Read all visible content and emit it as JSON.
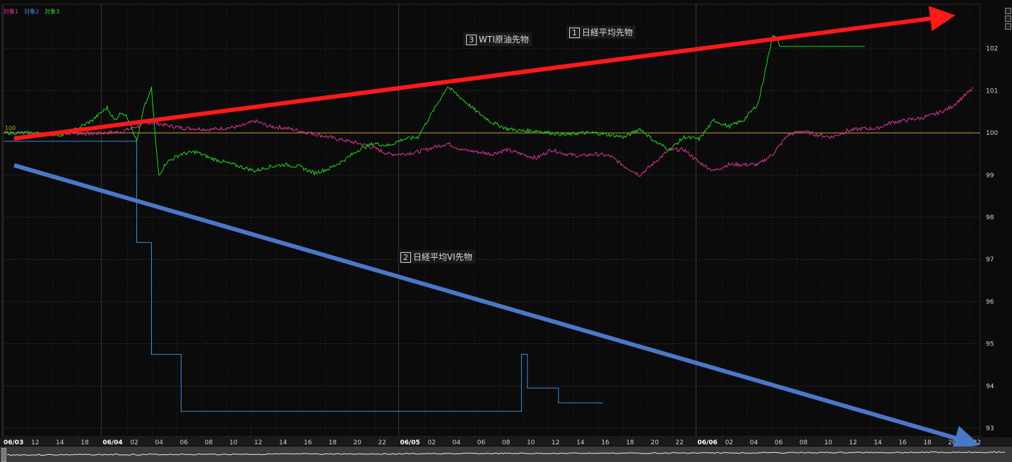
{
  "legend": [
    {
      "name": "対象1",
      "color": "#e0359a"
    },
    {
      "name": "対象2",
      "color": "#3b8ede"
    },
    {
      "name": "対象3",
      "color": "#22d622"
    }
  ],
  "annotations": [
    {
      "num": "1",
      "text": "日経平均先物"
    },
    {
      "num": "2",
      "text": "日経平均VI先物"
    },
    {
      "num": "3",
      "text": "WTI原油先物"
    }
  ],
  "chart_data": {
    "type": "line",
    "baseline": {
      "value": 100,
      "label": "100",
      "color": "#c8a020"
    },
    "y_ticks": [
      "102",
      "101",
      "100",
      "99",
      "98",
      "97",
      "96",
      "95",
      "94",
      "93"
    ],
    "ylim": [
      92.8,
      103.05
    ],
    "x_ticks": [
      {
        "label": "06/03",
        "bold": true
      },
      {
        "label": "12"
      },
      {
        "label": "14"
      },
      {
        "label": "18"
      },
      {
        "label": "06/04",
        "bold": true
      },
      {
        "label": "02"
      },
      {
        "label": "04"
      },
      {
        "label": "06"
      },
      {
        "label": "08"
      },
      {
        "label": "10"
      },
      {
        "label": "12"
      },
      {
        "label": "14"
      },
      {
        "label": "16"
      },
      {
        "label": "18"
      },
      {
        "label": "20"
      },
      {
        "label": "22"
      },
      {
        "label": "06/05",
        "bold": true
      },
      {
        "label": "02"
      },
      {
        "label": "04"
      },
      {
        "label": "06"
      },
      {
        "label": "08"
      },
      {
        "label": "10"
      },
      {
        "label": "12"
      },
      {
        "label": "14"
      },
      {
        "label": "16"
      },
      {
        "label": "18"
      },
      {
        "label": "20"
      },
      {
        "label": "22"
      },
      {
        "label": "06/06",
        "bold": true
      },
      {
        "label": "02"
      },
      {
        "label": "04"
      },
      {
        "label": "06"
      },
      {
        "label": "08"
      },
      {
        "label": "10"
      },
      {
        "label": "12"
      },
      {
        "label": "14"
      },
      {
        "label": "16"
      },
      {
        "label": "18"
      },
      {
        "label": "20"
      },
      {
        "label": "22"
      }
    ],
    "series": [
      {
        "name": "対象1",
        "color": "#e0359a",
        "points": [
          [
            0,
            100
          ],
          [
            2,
            100
          ],
          [
            4,
            100
          ],
          [
            6,
            99.98
          ],
          [
            8,
            100.03
          ],
          [
            9,
            100.15
          ],
          [
            10,
            100.25
          ],
          [
            11,
            100.18
          ],
          [
            12,
            100.12
          ],
          [
            14,
            100.08
          ],
          [
            16,
            100.15
          ],
          [
            17,
            100.28
          ],
          [
            18,
            100.15
          ],
          [
            19,
            100.12
          ],
          [
            20,
            100.05
          ],
          [
            22,
            99.9
          ],
          [
            24,
            99.75
          ],
          [
            25,
            99.65
          ],
          [
            26,
            99.5
          ],
          [
            27,
            99.5
          ],
          [
            28,
            99.55
          ],
          [
            29,
            99.65
          ],
          [
            30,
            99.75
          ],
          [
            31,
            99.6
          ],
          [
            32,
            99.55
          ],
          [
            33,
            99.5
          ],
          [
            34,
            99.6
          ],
          [
            35,
            99.5
          ],
          [
            36,
            99.4
          ],
          [
            37,
            99.6
          ],
          [
            38,
            99.5
          ],
          [
            39,
            99.45
          ],
          [
            40,
            99.5
          ],
          [
            41,
            99.45
          ],
          [
            42,
            99.2
          ],
          [
            43,
            99
          ],
          [
            44,
            99.3
          ],
          [
            45,
            99.6
          ],
          [
            46,
            99.6
          ],
          [
            47,
            99.3
          ],
          [
            48,
            99.1
          ],
          [
            49,
            99.25
          ],
          [
            50,
            99.25
          ],
          [
            51,
            99.25
          ],
          [
            52,
            99.5
          ],
          [
            53,
            99.95
          ],
          [
            54,
            100.05
          ],
          [
            55,
            99.95
          ],
          [
            56,
            99.9
          ],
          [
            57,
            100.05
          ],
          [
            58,
            100.1
          ],
          [
            59,
            100.1
          ],
          [
            60,
            100.25
          ],
          [
            61,
            100.3
          ],
          [
            62,
            100.35
          ],
          [
            63,
            100.45
          ],
          [
            64,
            100.6
          ],
          [
            65,
            100.9
          ],
          [
            65.5,
            101.05
          ]
        ]
      },
      {
        "name": "対象2",
        "color": "#3b8ede",
        "points": [
          [
            0,
            99.8
          ],
          [
            9,
            99.8
          ],
          [
            9,
            97.4
          ],
          [
            10,
            97.4
          ],
          [
            10,
            94.75
          ],
          [
            12,
            94.75
          ],
          [
            12,
            93.4
          ],
          [
            35,
            93.4
          ],
          [
            35,
            94.75
          ],
          [
            35.4,
            94.75
          ],
          [
            35.4,
            93.95
          ],
          [
            37.5,
            93.95
          ],
          [
            37.5,
            93.6
          ],
          [
            40.5,
            93.6
          ]
        ]
      },
      {
        "name": "対象3",
        "color": "#22d622",
        "points": [
          [
            0,
            100
          ],
          [
            2,
            100
          ],
          [
            4,
            99.95
          ],
          [
            5,
            100.1
          ],
          [
            6,
            100.3
          ],
          [
            7,
            100.6
          ],
          [
            7.5,
            100.3
          ],
          [
            8,
            100.5
          ],
          [
            8.5,
            100.3
          ],
          [
            9,
            99.8
          ],
          [
            9.5,
            100.6
          ],
          [
            10,
            101.05
          ],
          [
            10.3,
            99.7
          ],
          [
            10.5,
            99
          ],
          [
            11,
            99.3
          ],
          [
            12,
            99.5
          ],
          [
            13,
            99.55
          ],
          [
            14,
            99.4
          ],
          [
            15,
            99.3
          ],
          [
            16,
            99.2
          ],
          [
            17,
            99.1
          ],
          [
            18,
            99.2
          ],
          [
            19,
            99.25
          ],
          [
            20,
            99.2
          ],
          [
            21,
            99.05
          ],
          [
            22,
            99.15
          ],
          [
            23,
            99.35
          ],
          [
            24,
            99.6
          ],
          [
            25,
            99.75
          ],
          [
            26,
            99.7
          ],
          [
            27,
            99.85
          ],
          [
            28,
            99.9
          ],
          [
            29,
            100.5
          ],
          [
            30,
            101.1
          ],
          [
            31,
            100.8
          ],
          [
            32,
            100.5
          ],
          [
            33,
            100.25
          ],
          [
            34,
            100.1
          ],
          [
            35,
            100.05
          ],
          [
            36,
            100.05
          ],
          [
            37,
            100.0
          ],
          [
            38,
            99.95
          ],
          [
            39,
            100.0
          ],
          [
            40,
            100.0
          ],
          [
            41,
            99.95
          ],
          [
            42,
            99.9
          ],
          [
            43,
            100.1
          ],
          [
            44,
            99.8
          ],
          [
            45,
            99.6
          ],
          [
            46,
            99.9
          ],
          [
            47,
            99.85
          ],
          [
            48,
            100.3
          ],
          [
            49,
            100.15
          ],
          [
            50,
            100.3
          ],
          [
            51,
            100.7
          ],
          [
            52,
            102.35
          ],
          [
            52.5,
            102.05
          ],
          [
            58,
            102.05
          ],
          [
            58.2,
            102.05
          ]
        ]
      }
    ],
    "xlim": [
      0,
      66
    ]
  }
}
